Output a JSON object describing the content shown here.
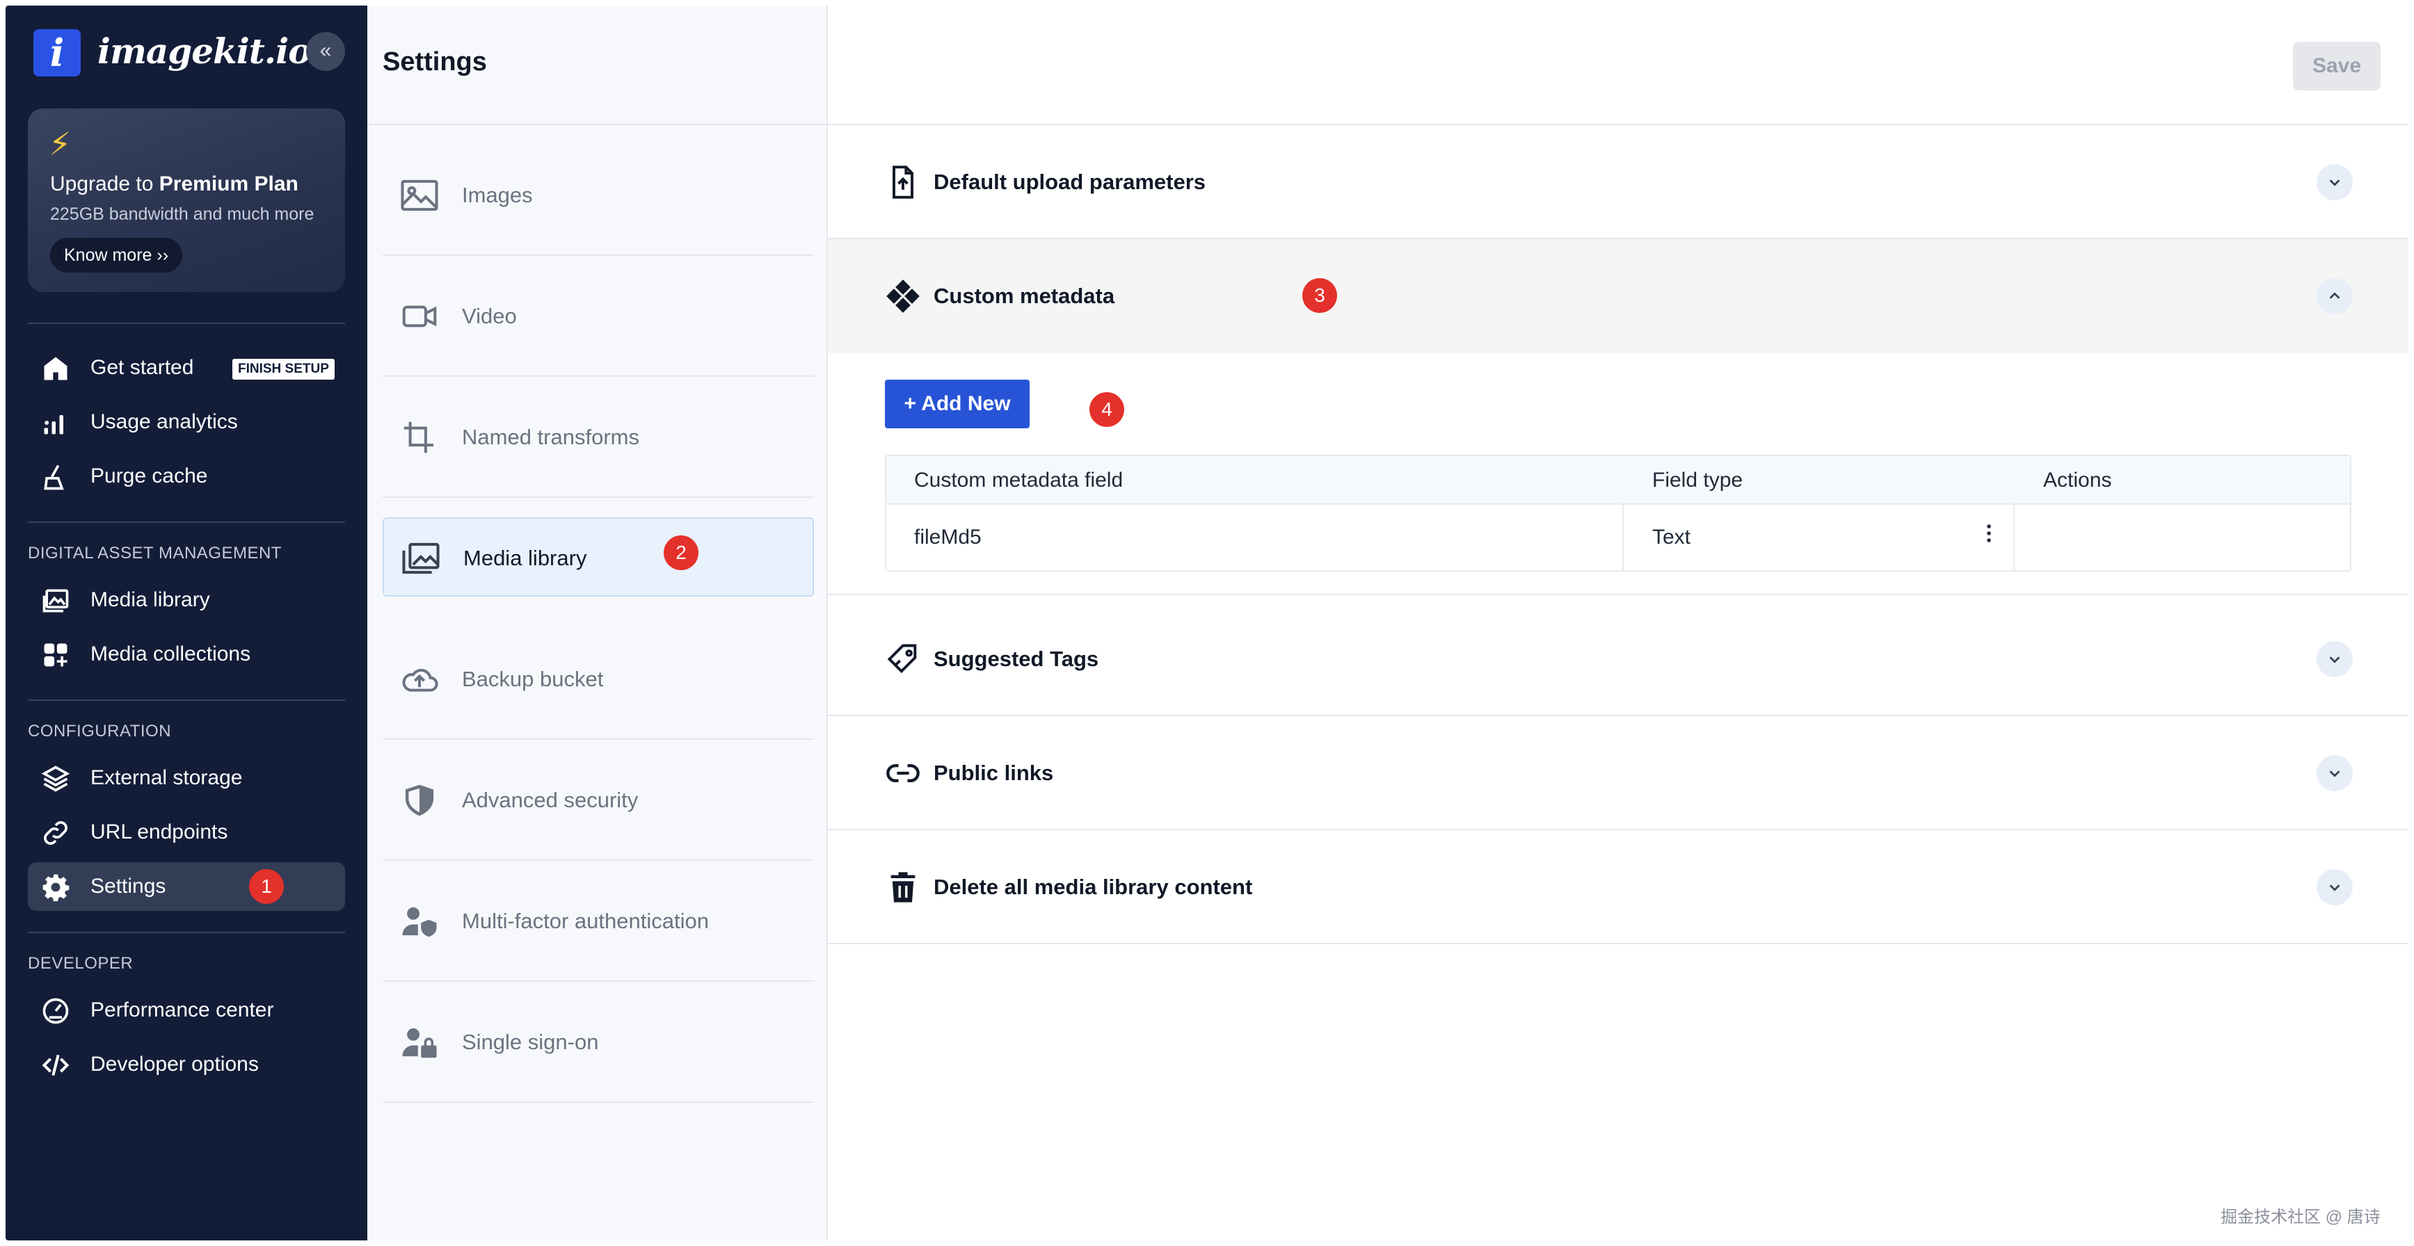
{
  "app": {
    "logo_letter": "i",
    "logo_text": "imagekit.io",
    "collapse_icon": "«"
  },
  "upgrade": {
    "prefix": "Upgrade to ",
    "plan": "Premium Plan",
    "subtitle": "225GB bandwidth and much more",
    "button": "Know more ››"
  },
  "sidebar": {
    "items": [
      {
        "label": "Get started",
        "icon": "home-icon",
        "badge": "FINISH SETUP"
      },
      {
        "label": "Usage analytics",
        "icon": "bar-chart-icon"
      },
      {
        "label": "Purge cache",
        "icon": "broom-icon"
      }
    ],
    "dam_heading": "DIGITAL ASSET MANAGEMENT",
    "dam_items": [
      {
        "label": "Media library",
        "icon": "gallery-icon"
      },
      {
        "label": "Media collections",
        "icon": "collections-icon"
      }
    ],
    "config_heading": "CONFIGURATION",
    "config_items": [
      {
        "label": "External storage",
        "icon": "layers-icon"
      },
      {
        "label": "URL endpoints",
        "icon": "link-icon"
      },
      {
        "label": "Settings",
        "icon": "gear-icon",
        "active": true
      }
    ],
    "dev_heading": "DEVELOPER",
    "dev_items": [
      {
        "label": "Performance center",
        "icon": "speedometer-icon"
      },
      {
        "label": "Developer options",
        "icon": "code-icon"
      }
    ]
  },
  "markers": [
    "1",
    "2",
    "3",
    "4"
  ],
  "settings_menu": {
    "title": "Settings",
    "items": [
      {
        "label": "Images",
        "icon": "image-icon"
      },
      {
        "label": "Video",
        "icon": "video-icon"
      },
      {
        "label": "Named transforms",
        "icon": "crop-icon"
      },
      {
        "label": "Media library",
        "icon": "gallery-icon",
        "active": true
      },
      {
        "label": "Backup bucket",
        "icon": "cloud-upload-icon"
      },
      {
        "label": "Advanced security",
        "icon": "shield-icon"
      },
      {
        "label": "Multi-factor authentication",
        "icon": "user-shield-icon"
      },
      {
        "label": "Single sign-on",
        "icon": "user-lock-icon"
      }
    ]
  },
  "content": {
    "save_label": "Save",
    "sections": [
      {
        "title": "Default upload parameters",
        "icon": "file-upload-icon",
        "expanded": false
      },
      {
        "title": "Custom metadata",
        "icon": "diamond-tiles-icon",
        "expanded": true
      },
      {
        "title": "Suggested Tags",
        "icon": "tag-icon",
        "expanded": false
      },
      {
        "title": "Public links",
        "icon": "link-icon",
        "expanded": false
      },
      {
        "title": "Delete all media library content",
        "icon": "trash-icon",
        "expanded": false
      }
    ],
    "add_new_label": "+ Add New",
    "table": {
      "columns": [
        "Custom metadata field",
        "Field type",
        "Actions"
      ],
      "rows": [
        {
          "field": "fileMd5",
          "type": "Text",
          "actions_icon": "kebab-menu-icon"
        }
      ]
    }
  },
  "watermark": "掘金技术社区 @ 唐诗",
  "colors": {
    "sidebar_bg": "#131d38",
    "accent": "#2754d6",
    "marker": "#e5312b",
    "active_menu": "#e8f1fc"
  }
}
